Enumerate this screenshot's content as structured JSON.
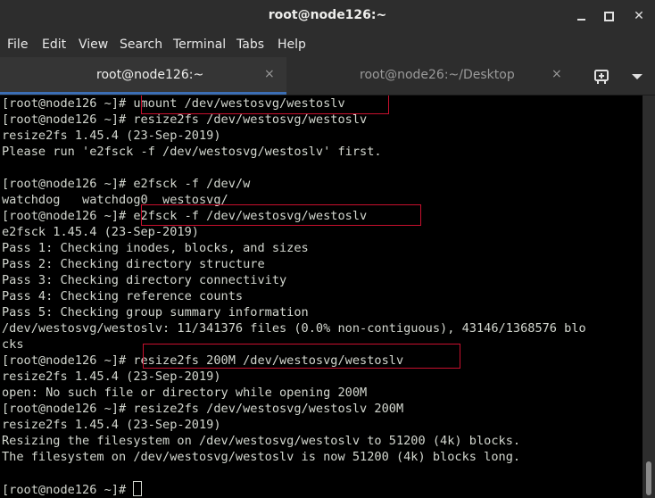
{
  "window": {
    "title": "root@node126:~"
  },
  "menu": [
    "File",
    "Edit",
    "View",
    "Search",
    "Terminal",
    "Tabs",
    "Help"
  ],
  "tabs": [
    {
      "label": "root@node126:~",
      "active": true
    },
    {
      "label": "root@node26:~/Desktop",
      "active": false
    }
  ],
  "icons": {
    "tab_close": "×",
    "window_close": "✕"
  },
  "terminal": {
    "lines": [
      "[root@node126 ~]# umount /dev/westosvg/westoslv",
      "[root@node126 ~]# resize2fs /dev/westosvg/westoslv",
      "resize2fs 1.45.4 (23-Sep-2019)",
      "Please run 'e2fsck -f /dev/westosvg/westoslv' first.",
      "",
      "[root@node126 ~]# e2fsck -f /dev/w",
      "watchdog   watchdog0  westosvg/",
      "[root@node126 ~]# e2fsck -f /dev/westosvg/westoslv",
      "e2fsck 1.45.4 (23-Sep-2019)",
      "Pass 1: Checking inodes, blocks, and sizes",
      "Pass 2: Checking directory structure",
      "Pass 3: Checking directory connectivity",
      "Pass 4: Checking reference counts",
      "Pass 5: Checking group summary information",
      "/dev/westosvg/westoslv: 11/341376 files (0.0% non-contiguous), 43146/1368576 blo",
      "cks",
      "[root@node126 ~]# resize2fs 200M /dev/westosvg/westoslv",
      "resize2fs 1.45.4 (23-Sep-2019)",
      "open: No such file or directory while opening 200M",
      "[root@node126 ~]# resize2fs /dev/westosvg/westoslv 200M",
      "resize2fs 1.45.4 (23-Sep-2019)",
      "Resizing the filesystem on /dev/westosvg/westoslv to 51200 (4k) blocks.",
      "The filesystem on /dev/westosvg/westoslv is now 51200 (4k) blocks long.",
      "",
      "[root@node126 ~]# "
    ]
  },
  "colors": {
    "terminal_bg": "#000000",
    "terminal_fg": "#d3d7cf",
    "highlight": "#c8102e",
    "tab_accent": "#3c6eb4"
  }
}
